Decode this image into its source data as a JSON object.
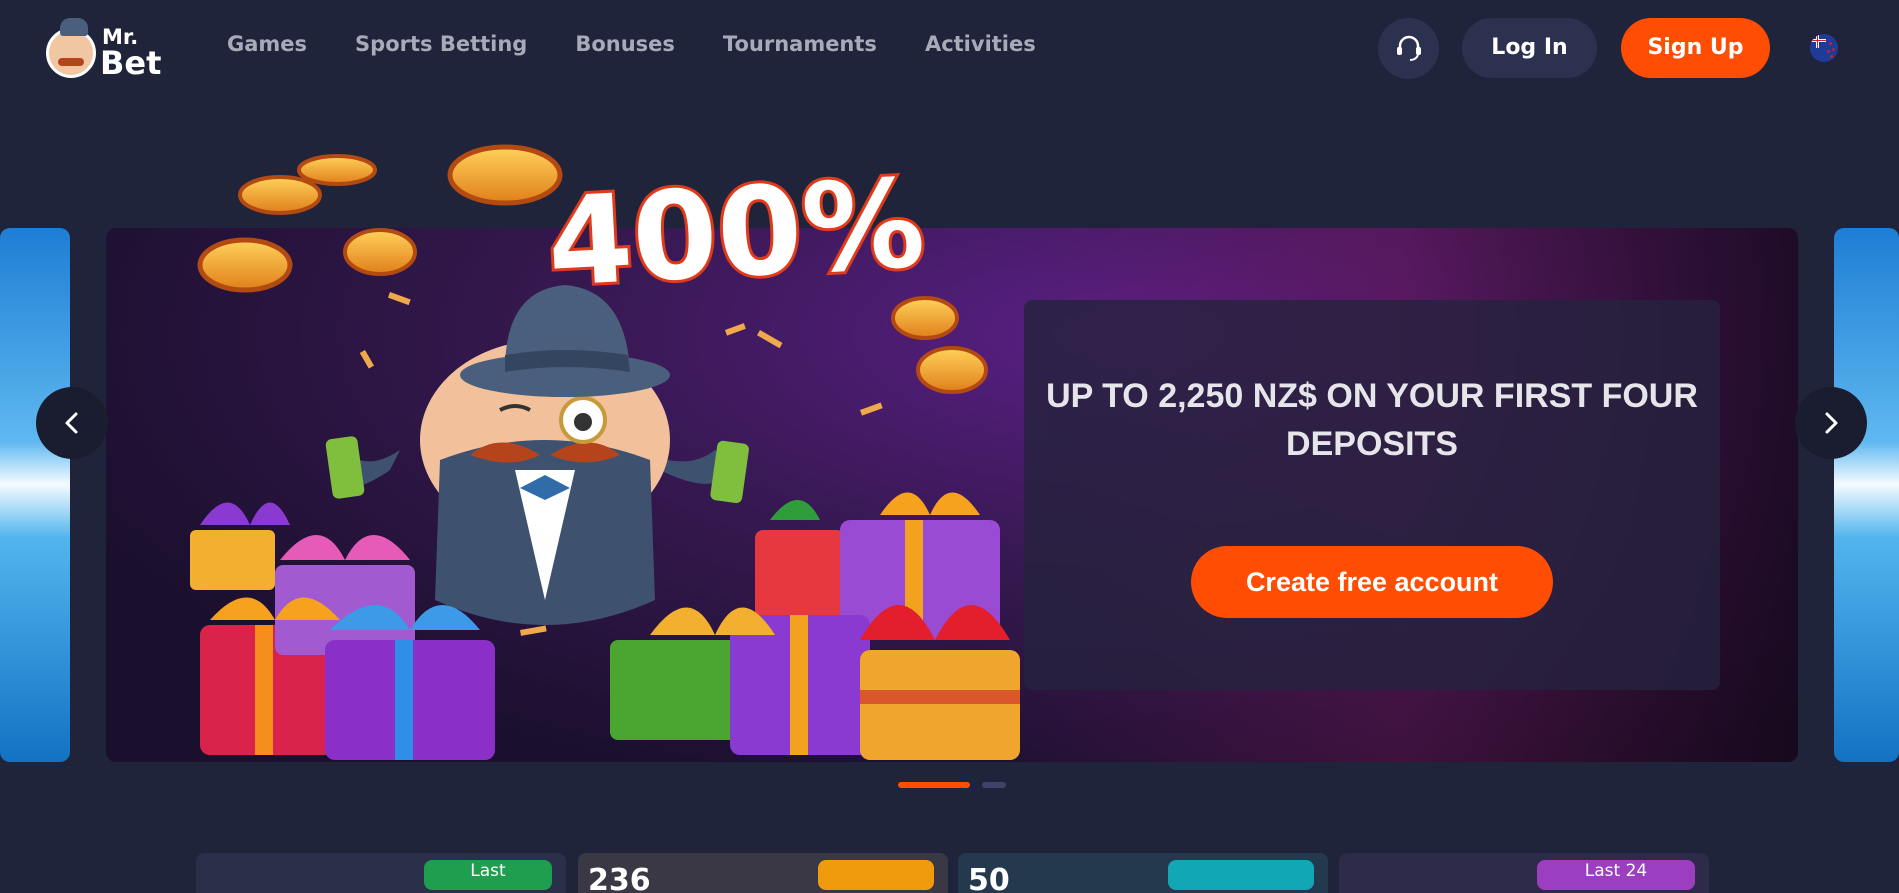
{
  "header": {
    "logo": {
      "line1": "Mr.",
      "line2": "Bet"
    },
    "nav": [
      "Games",
      "Sports Betting",
      "Bonuses",
      "Tournaments",
      "Activities"
    ],
    "support_icon": "headset-icon",
    "login_label": "Log In",
    "signup_label": "Sign Up",
    "language_icon": "new-zealand-flag-icon"
  },
  "carousel": {
    "headline_graphic": "400%",
    "promo_title": "UP TO 2,250 NZ$ ON YOUR FIRST FOUR DEPOSITS",
    "cta_label": "Create free account",
    "prev_icon": "chevron-left-icon",
    "next_icon": "chevron-right-icon",
    "slide_count": 2,
    "active_slide": 1
  },
  "cards": [
    {
      "badge": "Last",
      "badge_color": "#1f9e4f"
    },
    {
      "value": "236",
      "badge_color": "#f09a0e"
    },
    {
      "value": "50",
      "badge_color": "#12a7b5"
    },
    {
      "badge": "Last 24",
      "badge_color": "#9b3fc0"
    }
  ],
  "colors": {
    "accent": "#ff4e03",
    "background": "#20243a",
    "button_dark": "#2c3150"
  }
}
